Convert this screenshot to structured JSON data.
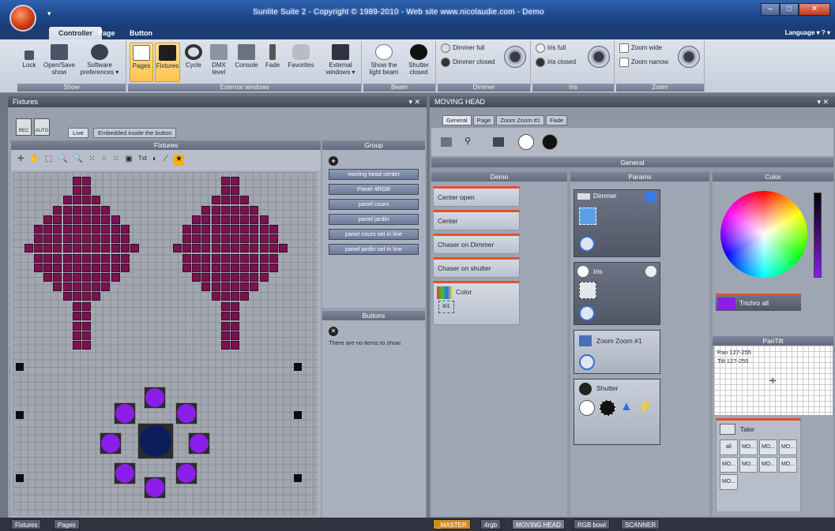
{
  "window": {
    "title": "Sunlite Suite 2 - Copyright © 1989-2010 - Web site www.nicolaudie.com - Demo",
    "quick_access": "▾"
  },
  "ribbon_tabs": [
    "Controller",
    "Page",
    "Button"
  ],
  "language": "Language ▾ ? ▾",
  "groups": {
    "show": {
      "label": "Show",
      "buttons": [
        "Lock",
        "Open/Save\nshow",
        "Software\npreferences ▾"
      ]
    },
    "external": {
      "label": "External windows",
      "buttons": [
        "Pages",
        "Fixtures",
        "Cycle",
        "DMX\nlevel",
        "Console",
        "Fade",
        "Favorites",
        "External\nwindows ▾"
      ]
    },
    "beam": {
      "label": "Beam",
      "buttons": [
        "Show the\nlight beam",
        "Shutter\nclosed"
      ]
    },
    "dimmer": {
      "label": "Dimmer",
      "buttons": [
        "Dimmer full",
        "Dimmer closed"
      ]
    },
    "iris": {
      "label": "Iris",
      "buttons": [
        "Iris full",
        "Iris closed"
      ]
    },
    "zoom": {
      "label": "Zoom",
      "buttons": [
        "Zoom wide",
        "Zoom narrow"
      ]
    }
  },
  "left_panel": {
    "title": "Fixtures",
    "rec": "REC",
    "auto": "AUTO",
    "tabs": [
      "Live",
      "Embedded inside the button"
    ],
    "fixtures_head": "Fixtures",
    "group_head": "Group",
    "groups": [
      "moving head center",
      "Panel 4RGB",
      "panel cours",
      "panel jardin",
      "panel cours sel in line",
      "panel jardin sel in line"
    ],
    "buttons_head": "Buttons",
    "no_items": "There are no items to show."
  },
  "right_panel": {
    "title": "MOVING HEAD",
    "tabs": [
      "General",
      "Page",
      "Zoom Zoom #1",
      "Fade"
    ],
    "general": "General",
    "demo_head": "Demo",
    "params_head": "Params",
    "color_head": "Color",
    "demo": [
      "Center open",
      "Center",
      "Chaser on Dimmer",
      "Chaser on shutter"
    ],
    "color_btn": "Color",
    "color_btn_sub": "bi1",
    "params": [
      "Dimmer",
      "Iris",
      "Zoom Zoom #1",
      "Shutter"
    ],
    "trichro": "Trichro all",
    "pantilt_head": "PanTilt",
    "pan": "Pan 127-255",
    "tilt": "Tilt 127-255",
    "take": "Take",
    "take_cells": [
      "all",
      "MO...",
      "MO...",
      "MO...",
      "MO...",
      "MO...",
      "MO...",
      "MO...",
      "MO..."
    ]
  },
  "status_left": [
    "Fixtures",
    "Pages"
  ],
  "status_right": [
    "_MASTER",
    "4rgb",
    "MOVING HEAD",
    "RGB bowl",
    "SCANNER"
  ]
}
